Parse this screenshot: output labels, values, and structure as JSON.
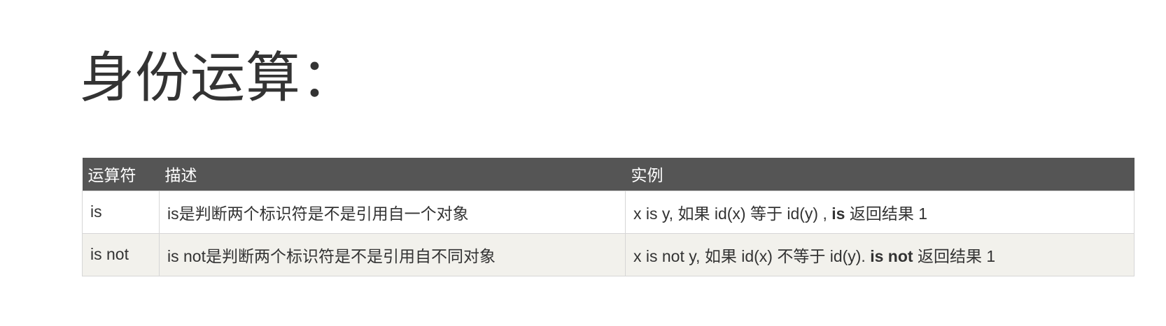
{
  "title": "身份运算：",
  "table": {
    "headers": [
      "运算符",
      "描述",
      "实例"
    ],
    "rows": [
      {
        "operator": "is",
        "description": "is是判断两个标识符是不是引用自一个对象",
        "example_prefix": "x is y, 如果 id(x) 等于 id(y) , ",
        "example_bold": "is",
        "example_suffix": " 返回结果 1"
      },
      {
        "operator": "is not",
        "description": "is not是判断两个标识符是不是引用自不同对象",
        "example_prefix": "x is not y, 如果 id(x) 不等于 id(y). ",
        "example_bold": "is not",
        "example_suffix": " 返回结果 1"
      }
    ]
  }
}
